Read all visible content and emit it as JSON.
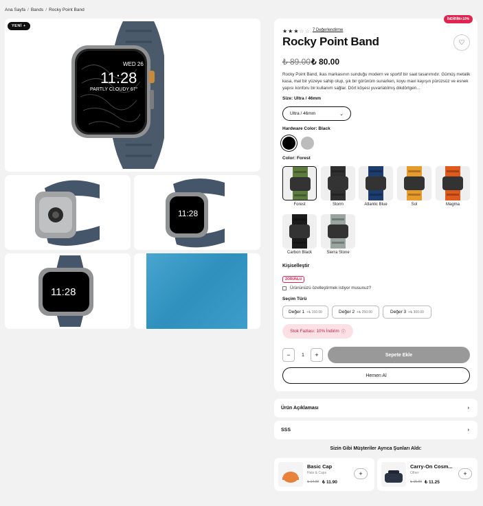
{
  "breadcrumb": {
    "home": "Ana Sayfa",
    "category": "Bands",
    "current": "Rocky Point Band",
    "sep": "/"
  },
  "gallery": {
    "new_badge": "YENİ +",
    "watch_screen": {
      "day": "WED 26",
      "time": "11:28",
      "weather": "PARTLY CLOUDY 67°"
    }
  },
  "product": {
    "discount_badge": "İNDİRİM+10%",
    "rating": {
      "filled": 3,
      "total": 5,
      "reviews_label": "7 Değerlendirme"
    },
    "title": "Rocky Point Band",
    "old_price": "₺ 89.00",
    "new_price": "₺ 80.00",
    "description": "Rocky Point Band, ikas markasının sunduğu modern ve sportif bir saat tasarımıdır. Gümüş metalik kasa, mat bir yüzeye sahip olup, şık bir görünüm sunarken, koyu mavi kayışın pürüzsüz ve esnek yapısı konforu bir kullanım sağlar. Dört köşesi yuvarlatılmış dikdörtgen..."
  },
  "size": {
    "label": "Size:",
    "value": "Ultra / 46mm",
    "selected": "Ultra / 46mm"
  },
  "hardware": {
    "label": "Hardware Color:",
    "value": "Black",
    "swatch_colors": [
      "#000000",
      "#bcbcbc"
    ]
  },
  "color": {
    "label": "Color:",
    "value": "Forest",
    "options": [
      {
        "name": "Forest",
        "band": "#5d7a3f"
      },
      {
        "name": "Storm",
        "band": "#2f2f2f"
      },
      {
        "name": "Atlantic Blue",
        "band": "#1e3d6f"
      },
      {
        "name": "Sol",
        "band": "#e69b2c"
      },
      {
        "name": "Magma",
        "band": "#e05a1e"
      },
      {
        "name": "Carbon Black",
        "band": "#1a1a1a"
      },
      {
        "name": "Sierra Stone",
        "band": "#9aa5a0"
      }
    ]
  },
  "personalize": {
    "title": "Kişiselleştir",
    "required": "ZORUNLU",
    "checkbox_label": "Ürününüzü özelleştirmek istiyor musunuz?",
    "choice_label": "Seçim Türü",
    "options": [
      {
        "label": "Değer 1",
        "price": "+₺ 150.00"
      },
      {
        "label": "Değer 2",
        "price": "+₺ 250.00"
      },
      {
        "label": "Değer 3",
        "price": "+₺ 300.00"
      }
    ]
  },
  "stock_badge": {
    "text": "Stok Fazlası: 10% İndirim",
    "icon": "info-icon"
  },
  "cart": {
    "minus": "−",
    "quantity": "1",
    "plus": "+",
    "add_to_cart": "Sepete Ekle",
    "buy_now": "Hemen Al"
  },
  "accordions": [
    {
      "title": "Ürün Açıklaması"
    },
    {
      "title": "SSS"
    }
  ],
  "recommendations": {
    "title": "Sizin Gibi Müşteriler Ayrıca Şunları Aldı:",
    "items": [
      {
        "name": "Basic Cap",
        "category": "Hats & Caps",
        "old_price": "₺ 14.00",
        "new_price": "₺ 11.90"
      },
      {
        "name": "Carry-On Cosm...",
        "category": "Other",
        "old_price": "₺ 15.00",
        "new_price": "₺ 11.25"
      }
    ]
  }
}
